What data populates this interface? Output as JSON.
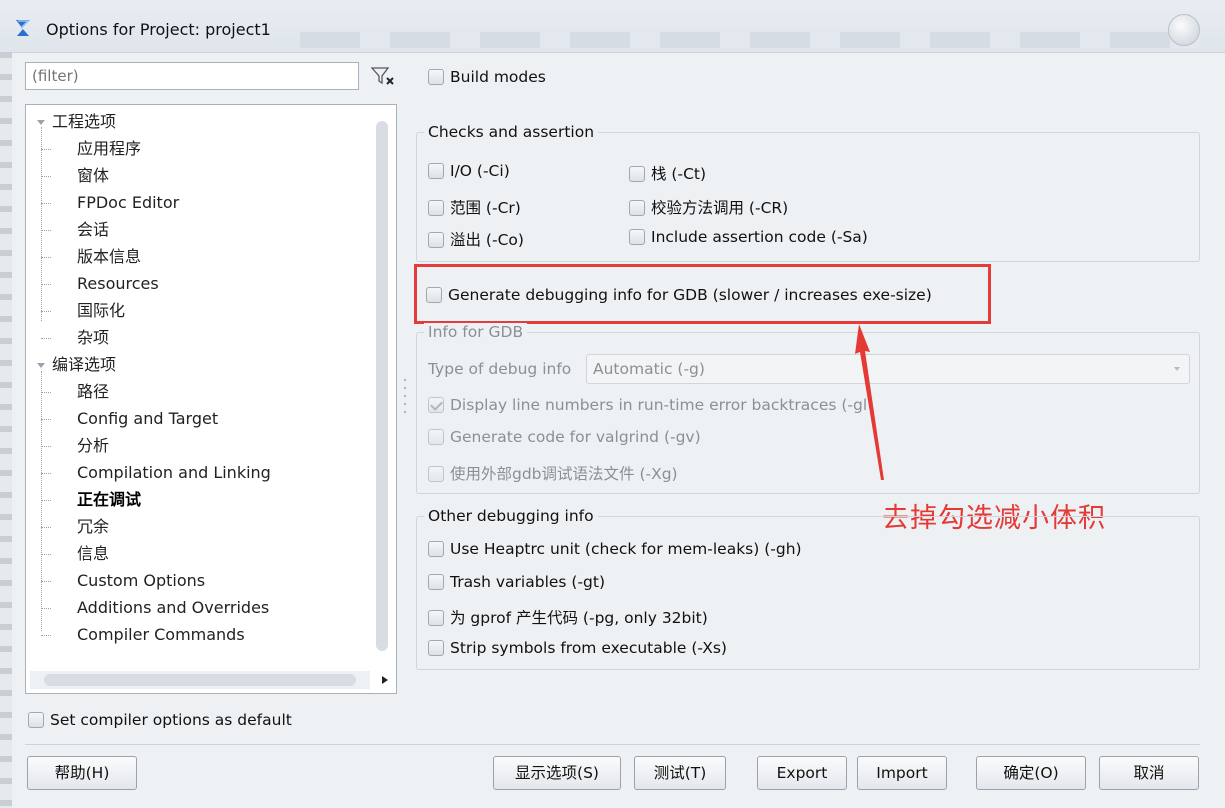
{
  "window": {
    "title": "Options for Project: project1"
  },
  "filter": {
    "placeholder": "(filter)"
  },
  "build_modes": {
    "label": "Build modes"
  },
  "tree": {
    "project_options": "工程选项",
    "project_children": [
      "应用程序",
      "窗体",
      "FPDoc Editor",
      "会话",
      "版本信息",
      "Resources",
      "国际化",
      "杂项"
    ],
    "compiler_options": "编译选项",
    "compiler_children": [
      "路径",
      "Config and Target",
      "分析",
      "Compilation and Linking",
      "正在调试",
      "冗余",
      "信息",
      "Custom Options",
      "Additions and Overrides",
      "Compiler Commands"
    ],
    "selected": "正在调试"
  },
  "checks": {
    "title": "Checks and assertion",
    "io": "I/O (-Ci)",
    "stack": "栈 (-Ct)",
    "range": "范围 (-Cr)",
    "verify_method": "校验方法调用 (-CR)",
    "overflow": "溢出 (-Co)",
    "assertion": "Include assertion code (-Sa)"
  },
  "gdb": {
    "generate_label": "Generate debugging info for GDB (slower / increases exe-size)",
    "info_title": "Info for GDB",
    "type_label": "Type of debug info",
    "type_value": "Automatic (-g)",
    "line_numbers": "Display line numbers in run-time error backtraces (-gl)",
    "valgrind": "Generate code for valgrind (-gv)",
    "external_gdb": "使用外部gdb调试语法文件 (-Xg)"
  },
  "other": {
    "title": "Other debugging info",
    "heaptrc": "Use Heaptrc unit (check for mem-leaks) (-gh)",
    "trash": "Trash variables (-gt)",
    "gprof": "为 gprof 产生代码 (-pg, only 32bit)",
    "strip": "Strip symbols from executable (-Xs)"
  },
  "annotation": {
    "text": "去掉勾选减小体积",
    "color": "#e53935"
  },
  "default_checkbox": {
    "label": "Set compiler options as default"
  },
  "buttons": {
    "help": "帮助(H)",
    "show_options": "显示选项(S)",
    "test": "测试(T)",
    "export": "Export",
    "import": "Import",
    "ok": "确定(O)",
    "cancel": "取消"
  }
}
